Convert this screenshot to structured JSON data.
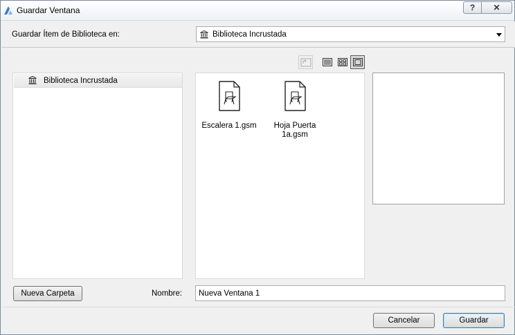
{
  "window": {
    "title": "Guardar Ventana",
    "help_label": "?",
    "close_label": "✕"
  },
  "location": {
    "label": "Guardar Ítem de Biblioteca en:",
    "selected": "Biblioteca Incrustada"
  },
  "tree": {
    "items": [
      {
        "label": "Biblioteca Incrustada"
      }
    ]
  },
  "files": [
    {
      "name": "Escalera 1.gsm"
    },
    {
      "name": "Hoja Puerta 1a.gsm"
    }
  ],
  "name_field": {
    "label": "Nombre:",
    "value": "Nueva Ventana 1"
  },
  "buttons": {
    "new_folder": "Nueva Carpeta",
    "cancel": "Cancelar",
    "save": "Guardar"
  },
  "view_modes": {
    "selected": "preview"
  },
  "colors": {
    "accent_border": "#3c7fb1",
    "app_icon": "#3a7bd5"
  }
}
